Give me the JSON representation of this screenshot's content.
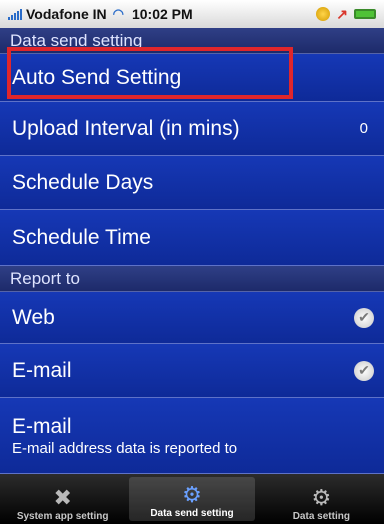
{
  "status_bar": {
    "carrier": "Vodafone IN",
    "time": "10:02 PM"
  },
  "sections": {
    "data_send": {
      "title": "Data send setting"
    },
    "report_to": {
      "title": "Report to"
    }
  },
  "rows": {
    "auto_send": {
      "label": "Auto Send Setting"
    },
    "upload_interval": {
      "label": "Upload Interval (in mins)",
      "value": "0"
    },
    "schedule_days": {
      "label": "Schedule Days"
    },
    "schedule_time": {
      "label": "Schedule Time"
    },
    "web": {
      "label": "Web",
      "checked": true
    },
    "email_toggle": {
      "label": "E-mail",
      "checked": true
    },
    "email_address": {
      "label": "E-mail",
      "subtitle": "E-mail address data is reported to"
    }
  },
  "tabs": [
    {
      "label": "System app setting",
      "icon": "tools-icon",
      "active": false
    },
    {
      "label": "Data send setting",
      "icon": "gears-icon",
      "active": true
    },
    {
      "label": "Data setting",
      "icon": "gear-icon",
      "active": false
    }
  ],
  "colors": {
    "row_background": "#1638b6",
    "header_background": "#2f3f86",
    "highlight_border": "#e0262b"
  }
}
